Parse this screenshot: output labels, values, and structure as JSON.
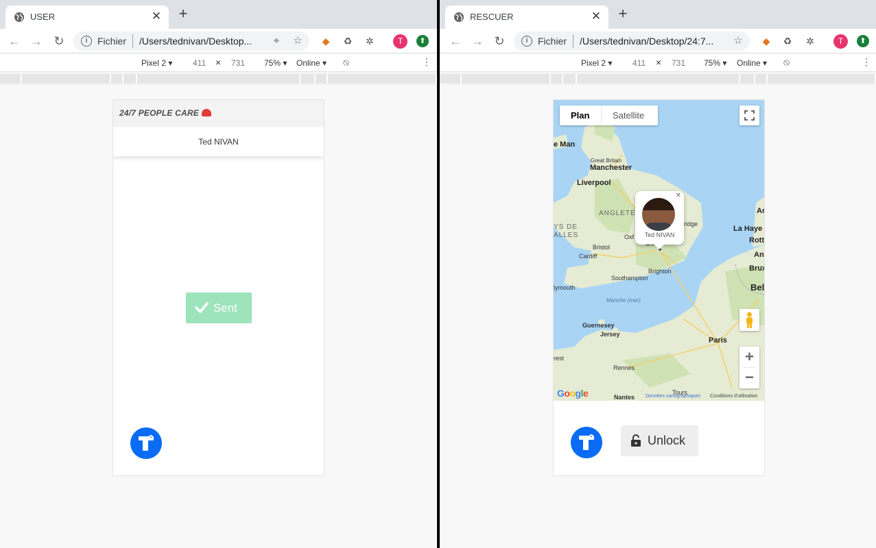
{
  "left_window": {
    "tab_title": "USER",
    "omnibox": {
      "scheme": "Fichier",
      "url": "/Users/tednivan/Desktop..."
    },
    "devtools": {
      "device": "Pixel 2 ▾",
      "width": "411",
      "height": "731",
      "zoom": "75% ▾",
      "network": "Online ▾"
    },
    "app": {
      "brand": "24/7 PEOPLE CARE",
      "user_name": "Ted NIVAN",
      "sent_label": "Sent"
    }
  },
  "right_window": {
    "tab_title": "RESCUER",
    "omnibox": {
      "scheme": "Fichier",
      "url": "/Users/tednivan/Desktop/24:7..."
    },
    "devtools": {
      "device": "Pixel 2 ▾",
      "width": "411",
      "height": "731",
      "zoom": "75% ▾",
      "network": "Online ▾"
    },
    "map": {
      "type_plan": "Plan",
      "type_satellite": "Satellite",
      "popup_name": "Ted NIVAN",
      "google": "Google",
      "attrib_data": "Données cartographiques",
      "attrib_terms": "Conditions d'utilisation",
      "labels": {
        "isle_of_man": "e Man",
        "manchester": "Manchester",
        "great_britain": "Great Britain",
        "liverpool": "Liverpool",
        "angleterre": "ANGLETE",
        "pays_de": "YS DE",
        "galles": "ALLES",
        "bridge": "ridge",
        "oxford": "Oxf",
        "london": "Lo",
        "bristol": "Bristol",
        "cardiff": "Cardiff",
        "brighton": "Brighton",
        "southampton": "Southampton",
        "plymouth": "lymouth",
        "manche": "Manche (mer)",
        "guernesey": "Guernesey",
        "jersey": "Jersey",
        "paris": "Paris",
        "brest": "rest",
        "rennes": "Rennes",
        "nantes": "Nantes",
        "tours": "Tours",
        "la_haye": "La Haye",
        "rotterdam": "Rott",
        "anvers": "Anv",
        "bruxelles": "Brux",
        "belgique": "Bel",
        "ar": "Ar"
      }
    },
    "unlock_label": "Unlock"
  },
  "colors": {
    "sent_green": "#9de3bb",
    "logo_blue": "#0a6cf5",
    "map_water": "#a9d4f4",
    "map_land": "#e8ecd9",
    "avatar_pink": "#e8336d"
  }
}
